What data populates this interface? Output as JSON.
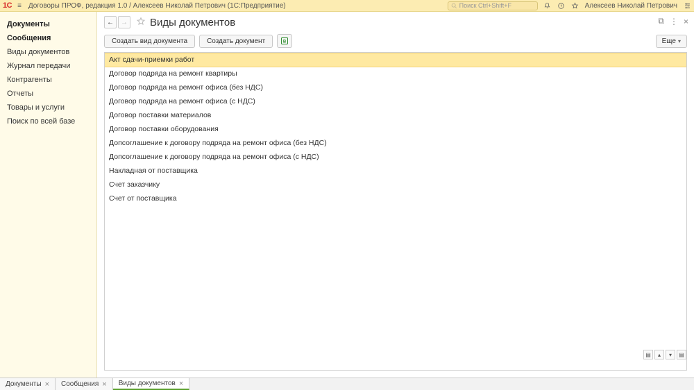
{
  "topbar": {
    "logo": "1C",
    "title": "Договоры ПРОФ, редакция 1.0 / Алексеев Николай Петрович  (1С:Предприятие)",
    "search_placeholder": "Поиск Ctrl+Shift+F",
    "username": "Алексеев Николай Петрович"
  },
  "sidebar": {
    "items": [
      {
        "label": "Документы",
        "bold": true
      },
      {
        "label": "Сообщения",
        "bold": true
      },
      {
        "label": "Виды документов",
        "bold": false
      },
      {
        "label": "Журнал передачи",
        "bold": false
      },
      {
        "label": "Контрагенты",
        "bold": false
      },
      {
        "label": "Отчеты",
        "bold": false
      },
      {
        "label": "Товары и услуги",
        "bold": false
      },
      {
        "label": "Поиск по всей базе",
        "bold": false
      }
    ]
  },
  "page": {
    "title": "Виды документов",
    "toolbar": {
      "btn_create_type": "Создать вид документа",
      "btn_create_doc": "Создать документ",
      "more_label": "Еще"
    },
    "rows": [
      "Акт сдачи-приемки работ",
      "Договор подряда на ремонт квартиры",
      "Договор подряда на ремонт офиса (без НДС)",
      "Договор подряда на ремонт офиса (с НДС)",
      "Договор поставки материалов",
      "Договор поставки оборудования",
      "Допсоглашение к договору подряда на ремонт офиса (без НДС)",
      "Допсоглашение к договору подряда на ремонт офиса (с НДС)",
      "Накладная от поставщика",
      "Счет заказчику",
      "Счет от поставщика"
    ],
    "selected_index": 0
  },
  "bottom_tabs": [
    {
      "label": "Документы",
      "active": false
    },
    {
      "label": "Сообщения",
      "active": false
    },
    {
      "label": "Виды документов",
      "active": true
    }
  ]
}
